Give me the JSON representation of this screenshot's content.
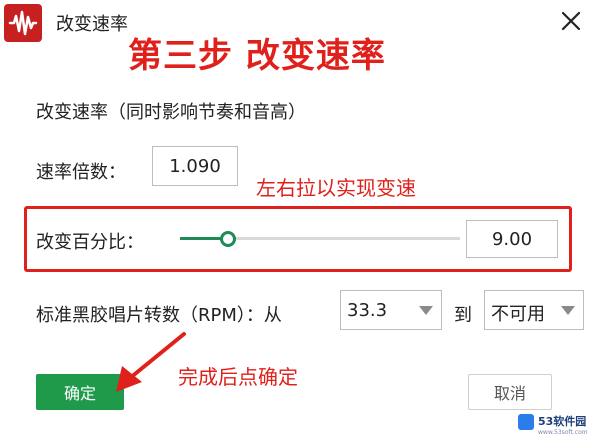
{
  "window": {
    "title": "改变速率",
    "close_icon": "close-icon",
    "app_icon": "audio-waveform-icon"
  },
  "annotations": {
    "step": "第三步 改变速率",
    "drag_hint": "左右拉以实现变速",
    "confirm_hint": "完成后点确定",
    "color": "#e0201b"
  },
  "form": {
    "section_heading": "改变速率（同时影响节奏和音高）",
    "rate_label": "速率倍数：",
    "rate_value": "1.090",
    "percent_label": "改变百分比：",
    "percent_value": "9.00",
    "slider_fraction": 0.17,
    "rpm_label": "标准黑胶唱片转数（RPM）：从",
    "rpm_from_value": "33.3",
    "rpm_to_label": "到",
    "rpm_to_value": "不可用"
  },
  "buttons": {
    "ok": "确定",
    "cancel": "取消"
  },
  "colors": {
    "accent_green": "#1f9a4a",
    "slider_green": "#1f8a55",
    "app_icon_red": "#c62020"
  },
  "watermark": {
    "text": "53软件园",
    "url": "www.53soft.com"
  }
}
